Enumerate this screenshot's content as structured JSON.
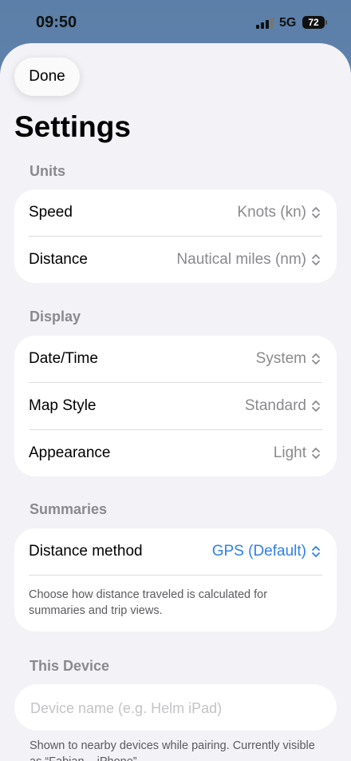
{
  "status_bar": {
    "time": "09:50",
    "network": "5G",
    "battery": "72"
  },
  "header": {
    "done_label": "Done",
    "title": "Settings"
  },
  "sections": {
    "units": {
      "title": "Units",
      "rows": [
        {
          "label": "Speed",
          "value": "Knots (kn)"
        },
        {
          "label": "Distance",
          "value": "Nautical miles (nm)"
        }
      ]
    },
    "display": {
      "title": "Display",
      "rows": [
        {
          "label": "Date/Time",
          "value": "System"
        },
        {
          "label": "Map Style",
          "value": "Standard"
        },
        {
          "label": "Appearance",
          "value": "Light"
        }
      ]
    },
    "summaries": {
      "title": "Summaries",
      "rows": [
        {
          "label": "Distance method",
          "value": "GPS (Default)"
        }
      ],
      "footnote": "Choose how distance traveled is calculated for summaries and trip views."
    },
    "this_device": {
      "title": "This Device",
      "name_value": "",
      "name_placeholder": "Device name (e.g. Helm iPad)",
      "footnote": "Shown to nearby devices while pairing. Currently visible as “Fabian – iPhone”."
    }
  },
  "icons": {
    "picker": "chevron-up-down-icon"
  },
  "colors": {
    "accent": "#2d7ff0",
    "secondary_text": "#8a8a8e",
    "background": "#f2f2f7"
  }
}
